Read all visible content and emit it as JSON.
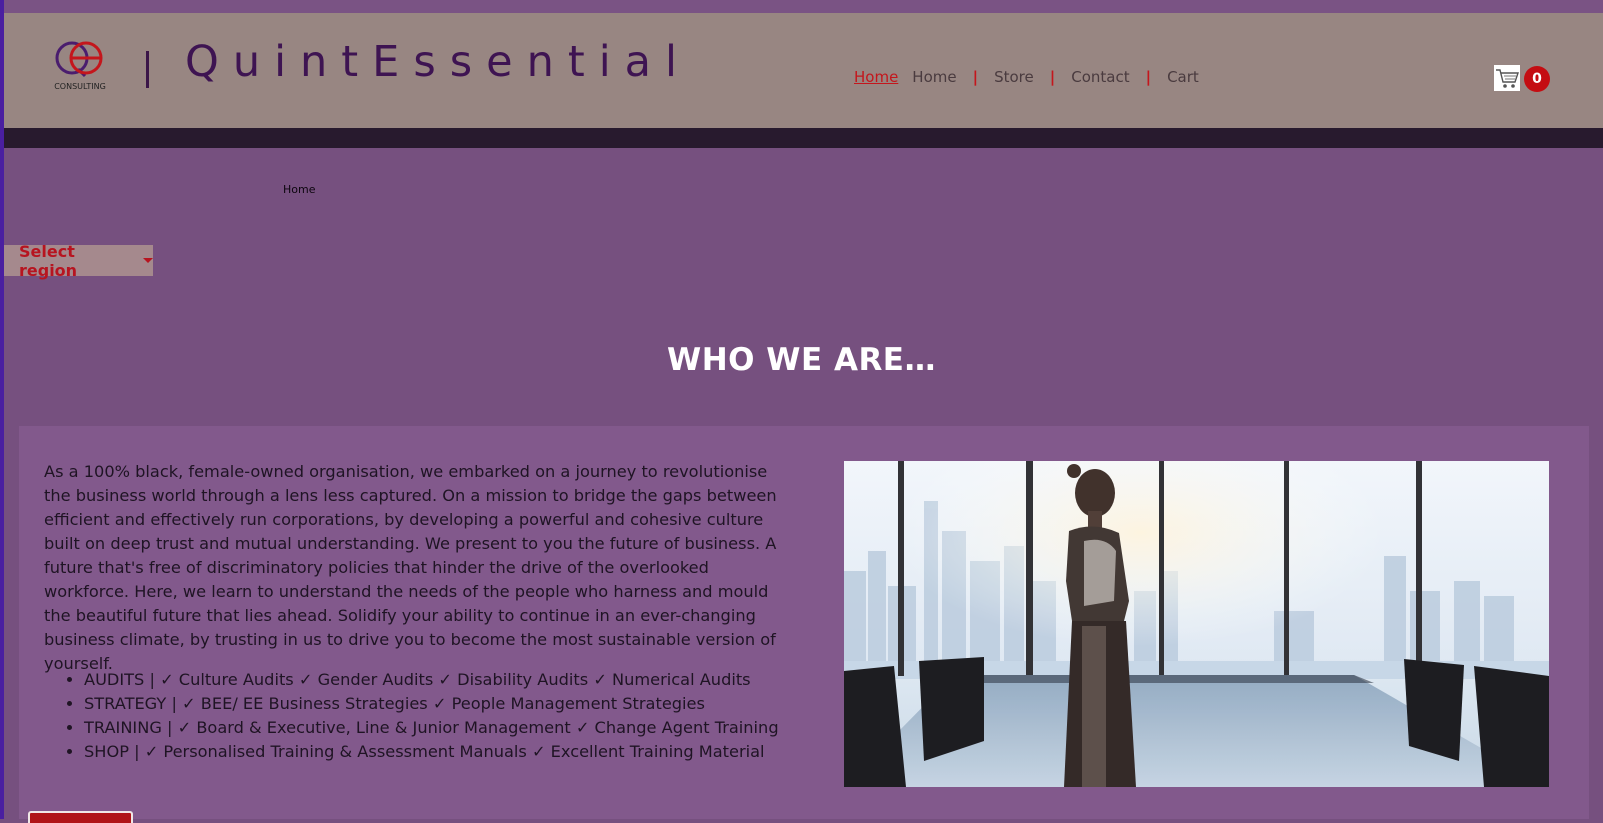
{
  "brand": {
    "logo_text": "CONSULTING",
    "name": "QuintEssential"
  },
  "nav": {
    "items": [
      {
        "label": "Home",
        "active": true
      },
      {
        "label": "Home"
      },
      {
        "label": "Store"
      },
      {
        "label": "Contact"
      },
      {
        "label": "Cart"
      }
    ],
    "separator": "|"
  },
  "cart": {
    "count": "0",
    "icon": "cart-icon"
  },
  "breadcrumb": {
    "current": "Home"
  },
  "region": {
    "label": "Select region"
  },
  "about": {
    "heading": "WHO WE ARE…",
    "paragraph": "As a 100% black, female-owned organisation, we embarked on a journey to revolutionise the business world through a lens less captured. On a mission to bridge the gaps between efficient and effectively run corporations, by developing a powerful and cohesive culture built on deep trust and mutual understanding. We present to you the future of business. A future that's free of discriminatory policies that hinder the drive of the overlooked workforce. Here, we learn to understand the needs of the people who harness and mould the beautiful future that lies ahead. Solidify your ability to continue in an ever-changing business climate, by trusting in us to drive you to become the most sustainable version of yourself.",
    "services": [
      "AUDITS | ✓ Culture Audits ✓ Gender Audits ✓ Disability Audits ✓ Numerical Audits",
      "STRATEGY | ✓ BEE/ EE Business Strategies ✓ People Management Strategies",
      "TRAINING | ✓ Board & Executive, Line & Junior Management ✓ Change Agent Training",
      "SHOP | ✓ Personalised Training & Assessment Manuals ✓ Excellent Training Material"
    ]
  },
  "colors": {
    "background": "#76507f",
    "header": "#988682",
    "accent": "#c4161c",
    "brand": "#3e1452"
  }
}
